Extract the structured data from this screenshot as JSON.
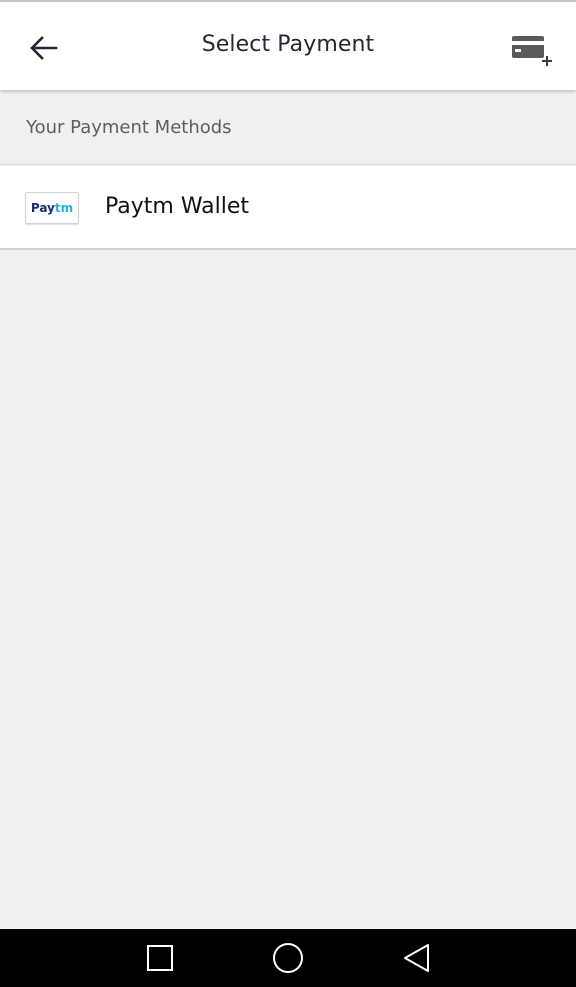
{
  "header": {
    "title": "Select Payment",
    "back_icon": "arrow-left-icon",
    "add_icon": "add-card-icon"
  },
  "section": {
    "title": "Your Payment Methods"
  },
  "payment_methods": [
    {
      "label": "Paytm Wallet",
      "logo": {
        "part1": "Pay",
        "part2": "tm"
      }
    }
  ],
  "nav": {
    "items": [
      "recent-apps-icon",
      "home-icon",
      "back-icon"
    ]
  },
  "colors": {
    "title": "#262637",
    "background": "#f0f0f2",
    "paytm_dark": "#1c2d6b",
    "paytm_light": "#22b1ea"
  }
}
